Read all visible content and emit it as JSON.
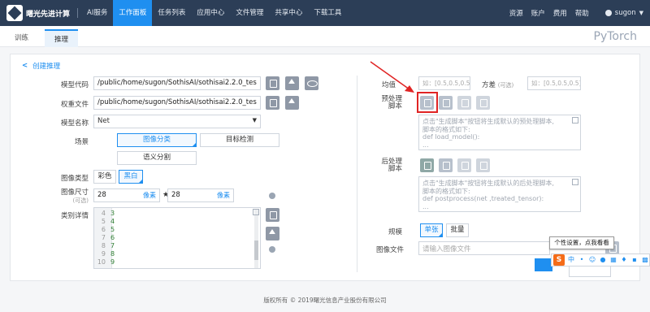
{
  "topbar": {
    "logo_text": "曙光先进计算",
    "divider_label": "AI服务",
    "nav": [
      "工作面板",
      "任务列表",
      "应用中心",
      "文件管理",
      "共享中心",
      "下载工具"
    ],
    "active_nav": "工作面板",
    "right": [
      "资源",
      "账户",
      "费用",
      "帮助"
    ],
    "user": "sugon"
  },
  "subtabs": {
    "train": "训练",
    "infer": "推理",
    "framework": "PyTorch"
  },
  "panel": {
    "back_label": "创建推理",
    "left": {
      "model_code_label": "模型代码",
      "model_code_value": "/public/home/sugon/SothisAI/sothisai2.2.0_tes",
      "weights_label": "权重文件",
      "weights_value": "/public/home/sugon/SothisAI/sothisai2.2.0_tes",
      "model_name_label": "模型名称",
      "model_name_value": "Net",
      "scene_label": "场景",
      "scene_options": [
        "图像分类",
        "目标检测",
        "语义分割"
      ],
      "image_type_label": "图像类型",
      "image_type_options": [
        "彩色",
        "黑白"
      ],
      "image_size_label": "图像尺寸",
      "image_size_sub": "(可选)",
      "width": "28",
      "height": "28",
      "unit": "像素",
      "class_detail_label": "类别详情",
      "class_lines": [
        {
          "n": "4",
          "v": "3"
        },
        {
          "n": "5",
          "v": "4"
        },
        {
          "n": "6",
          "v": "5"
        },
        {
          "n": "7",
          "v": "6"
        },
        {
          "n": "8",
          "v": "7"
        },
        {
          "n": "9",
          "v": "8"
        },
        {
          "n": "10",
          "v": "9"
        }
      ]
    },
    "right": {
      "mean_label": "均值",
      "mean_placeholder": "如：[0.5,0.5,0.5]",
      "std_label": "方差",
      "std_sub": "(可选)",
      "std_placeholder": "如：[0.5,0.5,0.5]",
      "pre_label_1": "预处理",
      "pre_label_2": "脚本",
      "pre_lines": [
        "点击\"生成脚本\"按钮将生成默认的预处理脚本,",
        "脚本的格式如下:",
        "def load_model():",
        "..."
      ],
      "post_label_1": "后处理",
      "post_label_2": "脚本",
      "post_lines": [
        "点击\"生成脚本\"按钮将生成默认的后处理脚本,",
        "脚本的格式如下:",
        "def postprocess(net ,treated_tensor):",
        "..."
      ],
      "scale_label": "规模",
      "scale_options": [
        "单张",
        "批量"
      ],
      "image_file_label": "图像文件",
      "image_file_placeholder": "请输入图像文件"
    }
  },
  "tooltip": "个性设置，点我看看",
  "ime": {
    "logo": "S",
    "mode": "中"
  },
  "footer": "版权所有 © 2019曙光信息产业股份有限公司",
  "colors": {
    "topbar": "#2c3e57",
    "accent": "#1f8ff0",
    "highlight": "#e02424"
  }
}
